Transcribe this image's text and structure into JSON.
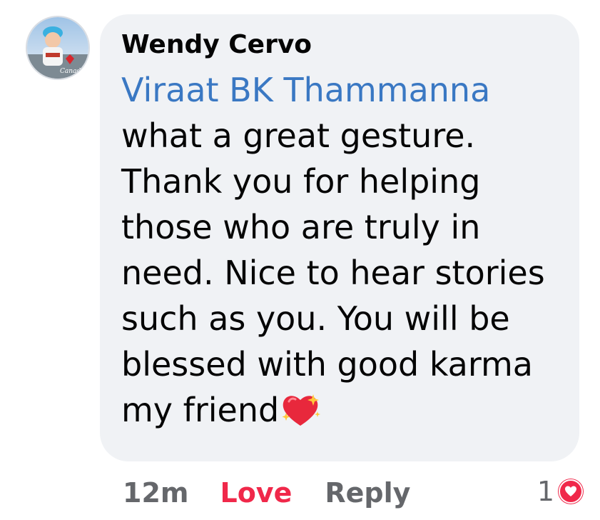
{
  "comment": {
    "author": "Wendy Cervo",
    "mention": "Viraat BK Thammanna",
    "lines": [
      "what a great gesture.",
      "Thank you for helping",
      "those who are truly in",
      "need. Nice to hear stories",
      "such as you. You will be",
      "blessed with good karma",
      "my friend"
    ],
    "emoji": "sparkling-heart"
  },
  "actions": {
    "time": "12m",
    "love_label": "Love",
    "reply_label": "Reply"
  },
  "reactions": {
    "count": "1",
    "type": "love",
    "color": "#f0284a"
  },
  "colors": {
    "bubble": "#f0f2f5",
    "mention": "#3a78c3",
    "love": "#f0284a",
    "meta": "#65676b"
  },
  "icons": [
    "avatar-photo",
    "sparkling-heart-emoji",
    "love-reaction-icon"
  ]
}
